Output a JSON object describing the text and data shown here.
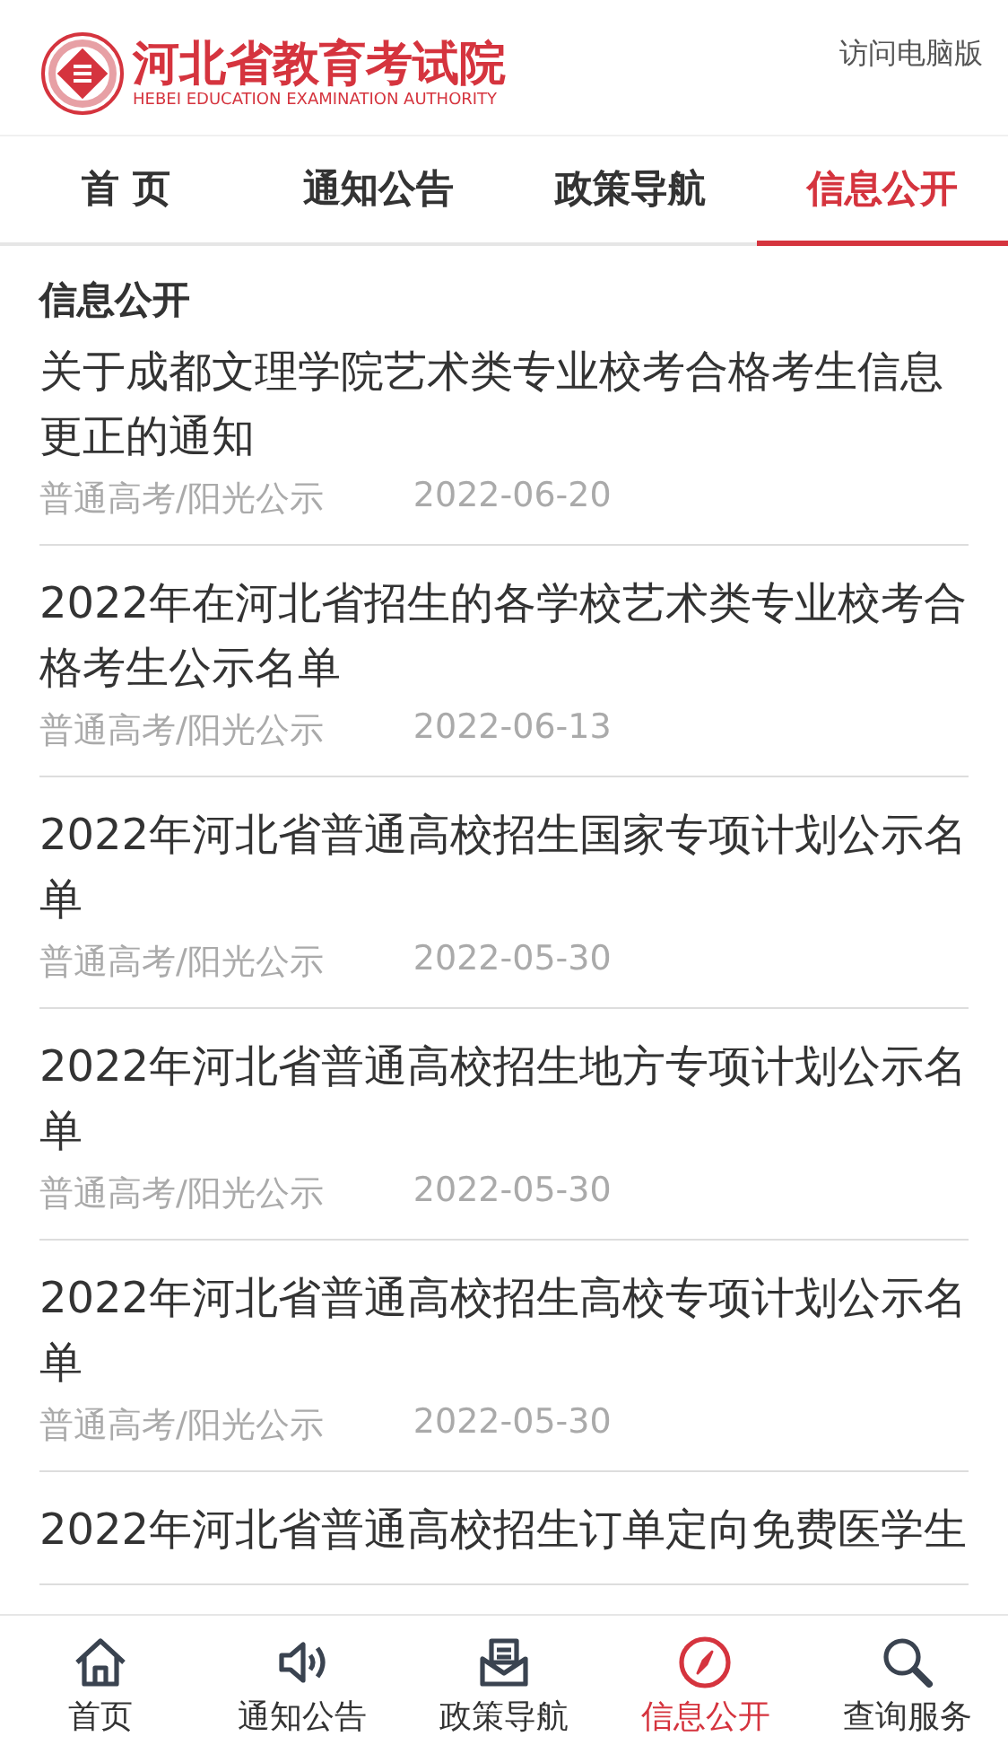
{
  "header": {
    "logo_title": "河北省教育考试院",
    "logo_subtitle": "HEBEI EDUCATION EXAMINATION AUTHORITY",
    "desktop_link": "访问电脑版"
  },
  "tabs": [
    {
      "label": "首 页",
      "selected": false
    },
    {
      "label": "通知公告",
      "selected": false
    },
    {
      "label": "政策导航",
      "selected": false
    },
    {
      "label": "信息公开",
      "selected": true
    }
  ],
  "section_title": "信息公开",
  "articles": [
    {
      "title": "关于成都文理学院艺术类专业校考合格考生信息更正的通知",
      "category": "普通高考/阳光公示",
      "date": "2022-06-20"
    },
    {
      "title": "2022年在河北省招生的各学校艺术类专业校考合格考生公示名单",
      "category": "普通高考/阳光公示",
      "date": "2022-06-13"
    },
    {
      "title": "2022年河北省普通高校招生国家专项计划公示名单",
      "category": "普通高考/阳光公示",
      "date": "2022-05-30"
    },
    {
      "title": "2022年河北省普通高校招生地方专项计划公示名单",
      "category": "普通高考/阳光公示",
      "date": "2022-05-30"
    },
    {
      "title": "2022年河北省普通高校招生高校专项计划公示名单",
      "category": "普通高考/阳光公示",
      "date": "2022-05-30"
    },
    {
      "title": "2022年河北省普通高校招生订单定向免费医学生"
    }
  ],
  "bottom_nav": [
    {
      "label": "首页",
      "kind": "home",
      "selected": false
    },
    {
      "label": "通知公告",
      "kind": "speaker",
      "selected": false
    },
    {
      "label": "政策导航",
      "kind": "document",
      "selected": false
    },
    {
      "label": "信息公开",
      "kind": "compass",
      "selected": true
    },
    {
      "label": "查询服务",
      "kind": "search",
      "selected": false
    }
  ]
}
